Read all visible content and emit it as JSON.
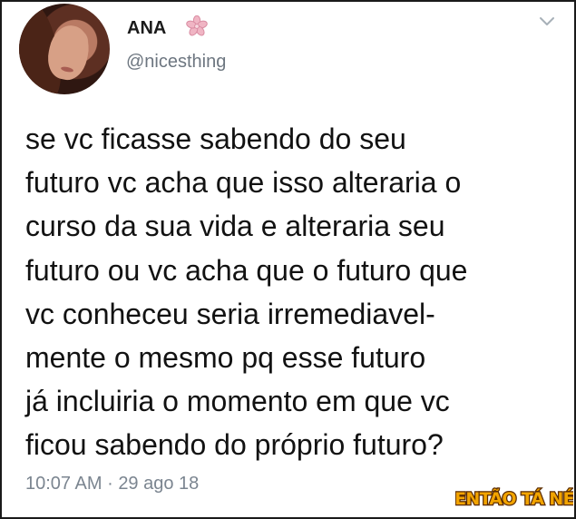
{
  "tweet": {
    "user": {
      "display_name": "ANA",
      "handle": "@nicesthing",
      "avatar_icon": "profile-photo",
      "badge_icon": "flower-icon"
    },
    "menu_icon": "chevron-down-icon",
    "text": "se vc ficasse sabendo do seu\nfuturo vc acha que isso alteraria o\ncurso da sua vida e alteraria seu\nfuturo ou vc acha que o futuro que\nvc conheceu seria irremediavel-\nmente o mesmo pq esse futuro\njá incluiria o momento em que vc\nficou sabendo do próprio futuro?",
    "time": "10:07 AM",
    "separator": "·",
    "date": "29 ago 18"
  },
  "watermark": {
    "text": "ENTÃO TÁ NÉ",
    "colors": {
      "fill": "#f2a400",
      "outline": "#5a2b00"
    }
  },
  "colors": {
    "text": "#121212",
    "secondary": "#6d7680",
    "accent_flower": "#e7a8b8"
  }
}
